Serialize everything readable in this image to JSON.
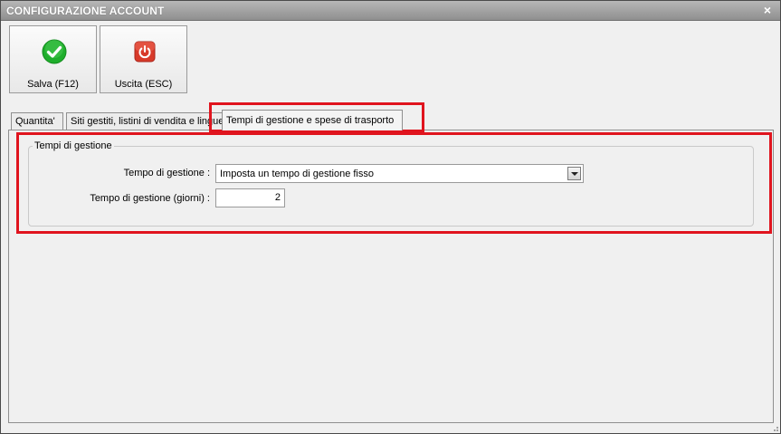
{
  "window": {
    "title": "CONFIGURAZIONE ACCOUNT",
    "close_glyph": "×"
  },
  "toolbar": {
    "save_label": "Salva (F12)",
    "save_icon": "check-icon",
    "save_color": "#1fae2c",
    "exit_label": "Uscita (ESC)",
    "exit_icon": "power-icon",
    "exit_color": "#d83a2a"
  },
  "tabs": [
    {
      "label": "Quantita'"
    },
    {
      "label": "Siti gestiti, listini di vendita e lingue"
    },
    {
      "label": "Tempi di gestione e spese di trasporto"
    }
  ],
  "group": {
    "title": "Tempi di gestione",
    "tempo_label": "Tempo di gestione :",
    "tempo_value": "Imposta un tempo di gestione fisso",
    "giorni_label": "Tempo di gestione (giorni) :",
    "giorni_value": "2"
  },
  "highlight_color": "#e0141e"
}
